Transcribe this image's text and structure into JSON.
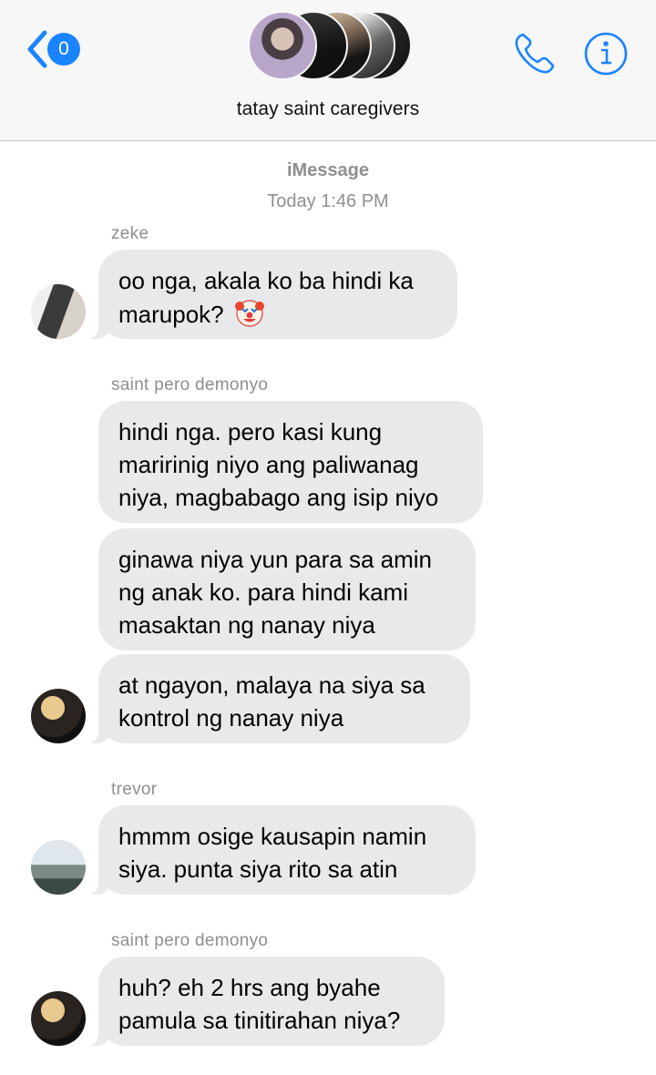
{
  "header": {
    "unread_count": "0",
    "group_name": "tatay saint caregivers",
    "icons": {
      "back": "chevron-left-icon",
      "call": "phone-icon",
      "info": "info-icon"
    },
    "accent": "#1a84ff"
  },
  "meta": {
    "service": "iMessage",
    "timestamp": "Today 1:46 PM"
  },
  "messages": [
    {
      "sender": "zeke",
      "lines": [
        "oo nga, akala ko ba hindi ka marupok?"
      ],
      "emoji": "clown-face"
    },
    {
      "sender": "saint pero demonyo",
      "lines": [
        "hindi nga. pero kasi kung maririnig niyo ang paliwanag niya, magbabago ang isip niyo",
        "ginawa niya yun para sa amin ng anak ko. para hindi kami masaktan ng nanay niya",
        "at ngayon, malaya na siya sa kontrol ng nanay niya"
      ]
    },
    {
      "sender": "trevor",
      "lines": [
        "hmmm osige kausapin namin siya. punta siya rito sa atin"
      ]
    },
    {
      "sender": "saint pero demonyo",
      "lines": [
        "huh? eh 2 hrs ang byahe pamula sa tinitirahan niya?"
      ]
    }
  ],
  "colors": {
    "bubble": "#e9e9eb",
    "meta_text": "#8e8e93",
    "header_bg": "#f7f7f7"
  }
}
